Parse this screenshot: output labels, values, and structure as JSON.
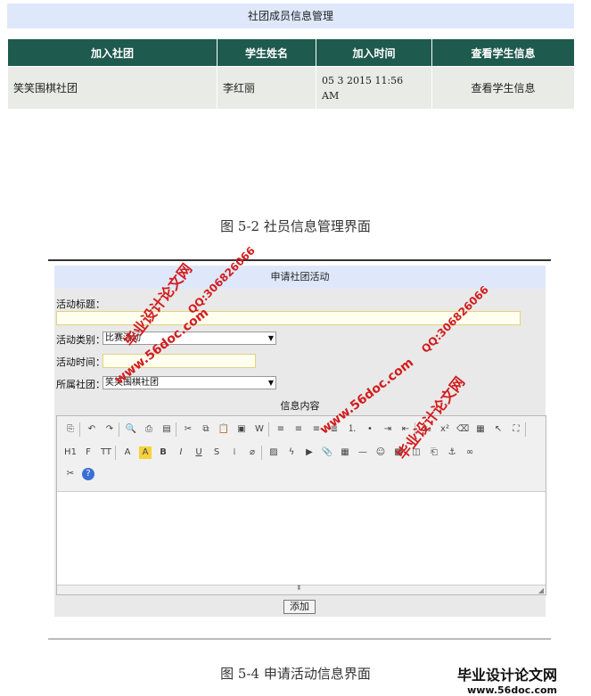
{
  "members_panel": {
    "title": "社团成员信息管理",
    "columns": [
      "加入社团",
      "学生姓名",
      "加入时间",
      "查看学生信息"
    ],
    "rows": [
      {
        "club": "笑笑围棋社团",
        "name": "李红丽",
        "time_line1": "05 3 2015 11:56",
        "time_line2": "AM",
        "action": "查看学生信息"
      }
    ]
  },
  "caption1": "图 5-2 社员信息管理界面",
  "form": {
    "title": "申请社团活动",
    "activity_title_label": "活动标题：",
    "activity_type_label": "活动类别：",
    "activity_type_value": "比赛活动",
    "activity_time_label": "活动时间：",
    "club_label": "所属社团：",
    "club_value": "笑笑围棋社团",
    "content_label": "信息内容",
    "add_button": "添加"
  },
  "caption2": "图 5-4 申请活动信息界面",
  "watermarks": {
    "site_name": "毕业设计论文网",
    "url": "www.56doc.com",
    "qq": "QQ:306826066"
  },
  "logo": {
    "text": "毕业设计论文网",
    "url": "www.56doc.com"
  },
  "toolbar_icons": [
    "source-icon",
    "undo-icon",
    "redo-icon",
    "preview-icon",
    "print-icon",
    "template-icon",
    "cut-icon",
    "copy-icon",
    "paste-icon",
    "paste-text-icon",
    "paste-word-icon",
    "align-left-icon",
    "align-center-icon",
    "align-right-icon",
    "justify-icon",
    "ordered-list-icon",
    "unordered-list-icon",
    "indent-icon",
    "outdent-icon",
    "subscript-icon",
    "superscript-icon",
    "clear-format-icon",
    "select-all-icon",
    "cursor-icon",
    "fullscreen-icon",
    "heading-icon",
    "font-family-icon",
    "font-size-icon",
    "text-color-icon",
    "highlight-icon",
    "bold-icon",
    "italic-icon",
    "underline-icon",
    "strikethrough-icon",
    "line-height-icon",
    "remove-format-icon",
    "image-icon",
    "flash-icon",
    "media-icon",
    "attachment-icon",
    "table-icon",
    "hr-icon",
    "emoticon-icon",
    "map-icon",
    "code-icon",
    "pagebreak-icon",
    "anchor-icon",
    "link-icon",
    "unlink-icon",
    "help-icon"
  ]
}
